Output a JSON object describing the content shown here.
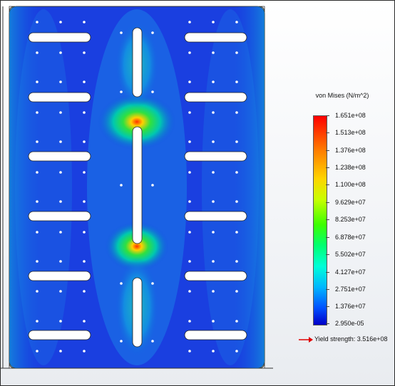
{
  "legend": {
    "title": "von Mises (N/m^2)",
    "ticks": [
      "1.651e+08",
      "1.513e+08",
      "1.376e+08",
      "1.238e+08",
      "1.100e+08",
      "9.629e+07",
      "8.253e+07",
      "6.878e+07",
      "5.502e+07",
      "4.127e+07",
      "2.751e+07",
      "1.376e+07",
      "2.950e-05"
    ],
    "yield_label": "Yield strength: 3.516e+08"
  },
  "colors": {
    "max": "#ff0000",
    "min": "#0000c8",
    "yield_arrow": "#e00000"
  }
}
